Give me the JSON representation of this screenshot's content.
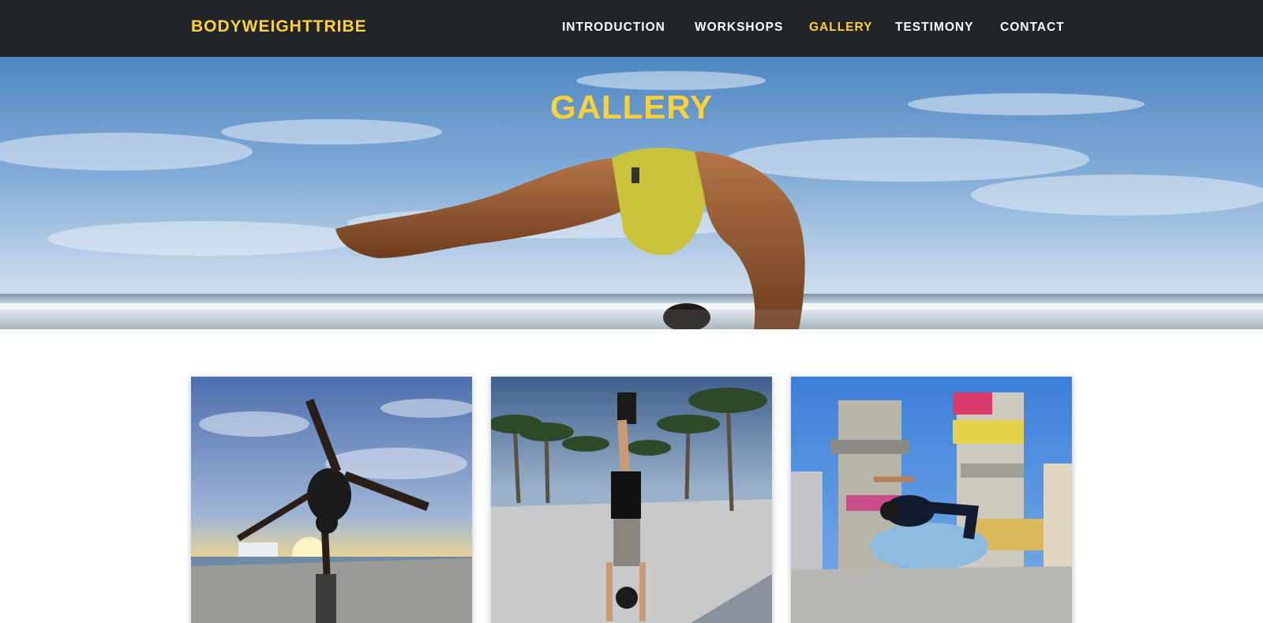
{
  "navbar": {
    "brand": "BODYWEIGHTTRIBE",
    "links": [
      {
        "label": "INTRODUCTION",
        "active": false
      },
      {
        "label": "WORKSHOPS",
        "active": false
      },
      {
        "label": "GALLERY",
        "active": true
      },
      {
        "label": "TESTIMONY",
        "active": false
      },
      {
        "label": "CONTACT",
        "active": false
      }
    ]
  },
  "hero": {
    "title": "GALLERY"
  },
  "gallery": {
    "items": [
      {
        "subject": "one-arm handstand by the sea at sunset"
      },
      {
        "subject": "handstand among palm trees"
      },
      {
        "subject": "mid-air flip in front of colorful towers"
      }
    ]
  },
  "colors": {
    "navbar_bg": "#212529",
    "accent": "#fed136",
    "nav_text": "#ffffff"
  }
}
